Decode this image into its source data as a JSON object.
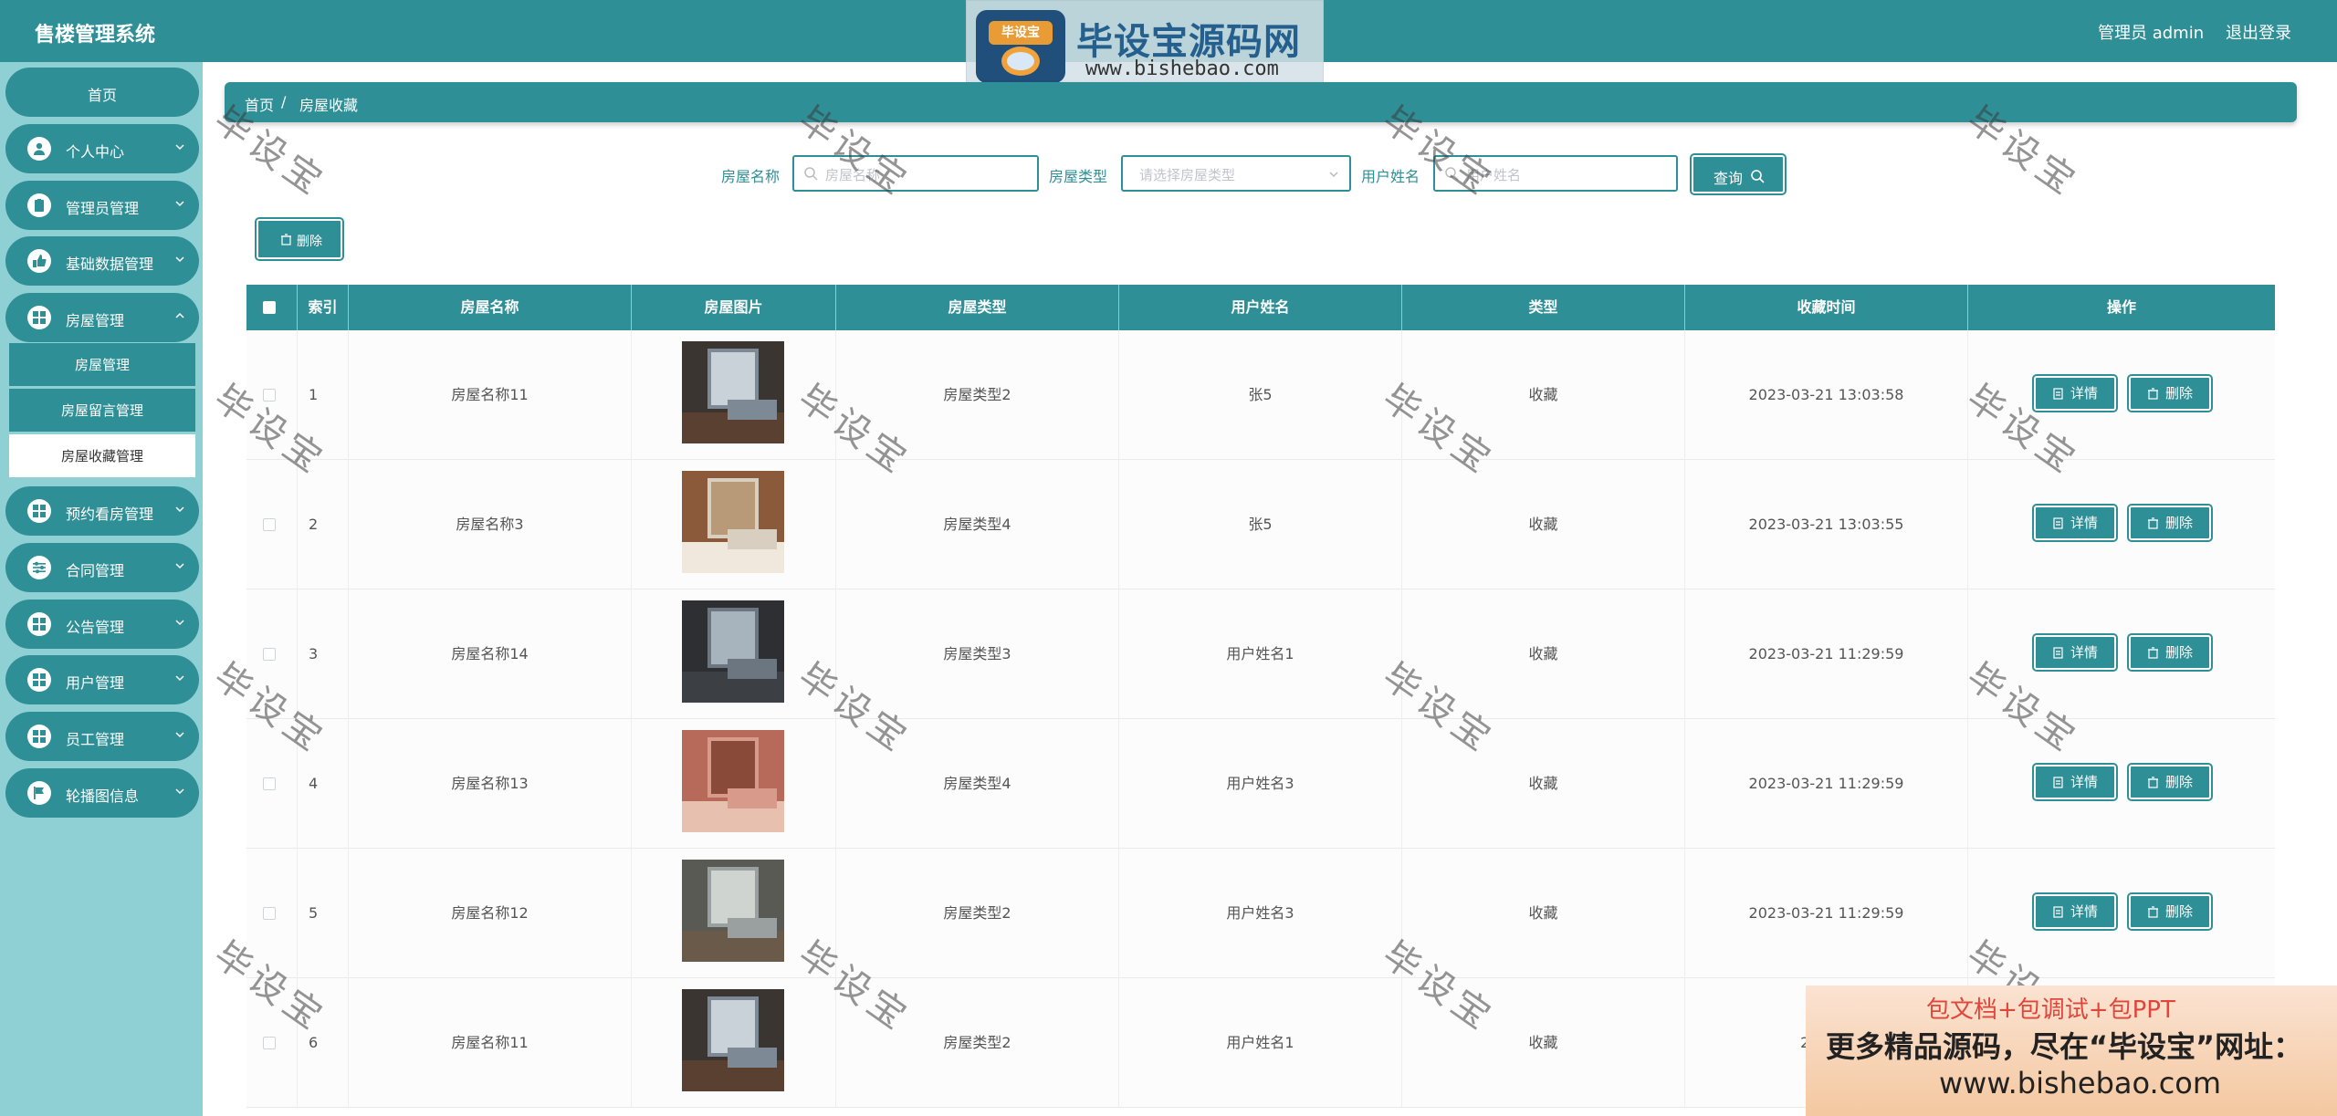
{
  "header": {
    "app_title": "售楼管理系统",
    "user_label": "管理员 admin",
    "logout_label": "退出登录"
  },
  "brand": {
    "logo_text": "毕设宝",
    "name": "毕设宝源码网",
    "url": "www.bishebao.com"
  },
  "sidebar": {
    "home": "首页",
    "items": [
      {
        "label": "个人中心",
        "icon": "user-icon"
      },
      {
        "label": "管理员管理",
        "icon": "clipboard-icon"
      },
      {
        "label": "基础数据管理",
        "icon": "thumbs-up-icon"
      },
      {
        "label": "房屋管理",
        "icon": "grid-icon"
      },
      {
        "label": "预约看房管理",
        "icon": "grid-icon"
      },
      {
        "label": "合同管理",
        "icon": "sliders-icon"
      },
      {
        "label": "公告管理",
        "icon": "grid-icon"
      },
      {
        "label": "用户管理",
        "icon": "grid-icon"
      },
      {
        "label": "员工管理",
        "icon": "grid-icon"
      },
      {
        "label": "轮播图信息",
        "icon": "flag-icon"
      }
    ],
    "submenu": [
      {
        "label": "房屋管理"
      },
      {
        "label": "房屋留言管理"
      },
      {
        "label": "房屋收藏管理"
      }
    ]
  },
  "breadcrumb": {
    "home": "首页",
    "separator": "/",
    "current": "房屋收藏"
  },
  "search": {
    "house_name_label": "房屋名称",
    "house_name_placeholder": "房屋名称",
    "house_type_label": "房屋类型",
    "house_type_placeholder": "请选择房屋类型",
    "user_name_label": "用户姓名",
    "user_name_placeholder": "用户姓名",
    "query_button": "查询"
  },
  "toolbar": {
    "delete_button": "删除"
  },
  "table": {
    "columns": [
      "索引",
      "房屋名称",
      "房屋图片",
      "房屋类型",
      "用户姓名",
      "类型",
      "收藏时间",
      "操作"
    ],
    "detail_label": "详情",
    "delete_label": "删除",
    "rows": [
      {
        "index": "1",
        "name": "房屋名称11",
        "type": "房屋类型2",
        "user": "张5",
        "kind": "收藏",
        "time": "2023-03-21 13:03:58"
      },
      {
        "index": "2",
        "name": "房屋名称3",
        "type": "房屋类型4",
        "user": "张5",
        "kind": "收藏",
        "time": "2023-03-21 13:03:55"
      },
      {
        "index": "3",
        "name": "房屋名称14",
        "type": "房屋类型3",
        "user": "用户姓名1",
        "kind": "收藏",
        "time": "2023-03-21 11:29:59"
      },
      {
        "index": "4",
        "name": "房屋名称13",
        "type": "房屋类型4",
        "user": "用户姓名3",
        "kind": "收藏",
        "time": "2023-03-21 11:29:59"
      },
      {
        "index": "5",
        "name": "房屋名称12",
        "type": "房屋类型2",
        "user": "用户姓名3",
        "kind": "收藏",
        "time": "2023-03-21 11:29:59"
      },
      {
        "index": "6",
        "name": "房屋名称11",
        "type": "房屋类型2",
        "user": "用户姓名1",
        "kind": "收藏",
        "time": "2023-0"
      }
    ]
  },
  "watermark": "毕设宝",
  "ad": {
    "line1": "包文档+包调试+包PPT",
    "line2": "更多精品源码，尽在“毕设宝”网址：",
    "line3": "www.bishebao.com"
  },
  "colors": {
    "primary": "#2f8f96",
    "sidebar_bg": "#8fd0d4"
  }
}
